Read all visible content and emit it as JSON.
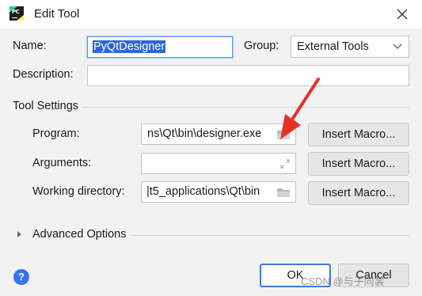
{
  "window": {
    "title": "Edit Tool",
    "app_icon": "pycharm-app-icon"
  },
  "form": {
    "name_label": "Name:",
    "name_value": "PyQtDesigner",
    "group_label": "Group:",
    "group_value": "External Tools",
    "description_label": "Description:",
    "description_value": ""
  },
  "tool_settings": {
    "title": "Tool Settings",
    "program_label": "Program:",
    "program_value": "ns\\Qt\\bin\\designer.exe",
    "arguments_label": "Arguments:",
    "arguments_value": "",
    "working_dir_label": "Working directory:",
    "working_dir_value": "|t5_applications\\Qt\\bin",
    "insert_macro_label": "Insert Macro..."
  },
  "advanced": {
    "title": "Advanced Options"
  },
  "footer": {
    "ok_label": "OK",
    "cancel_label": "Cancel",
    "help_glyph": "?"
  },
  "watermark": "CSDN @与子同裳",
  "colors": {
    "accent": "#3574f0",
    "selection": "#2e67d2",
    "annotation_arrow": "#e8302a"
  }
}
